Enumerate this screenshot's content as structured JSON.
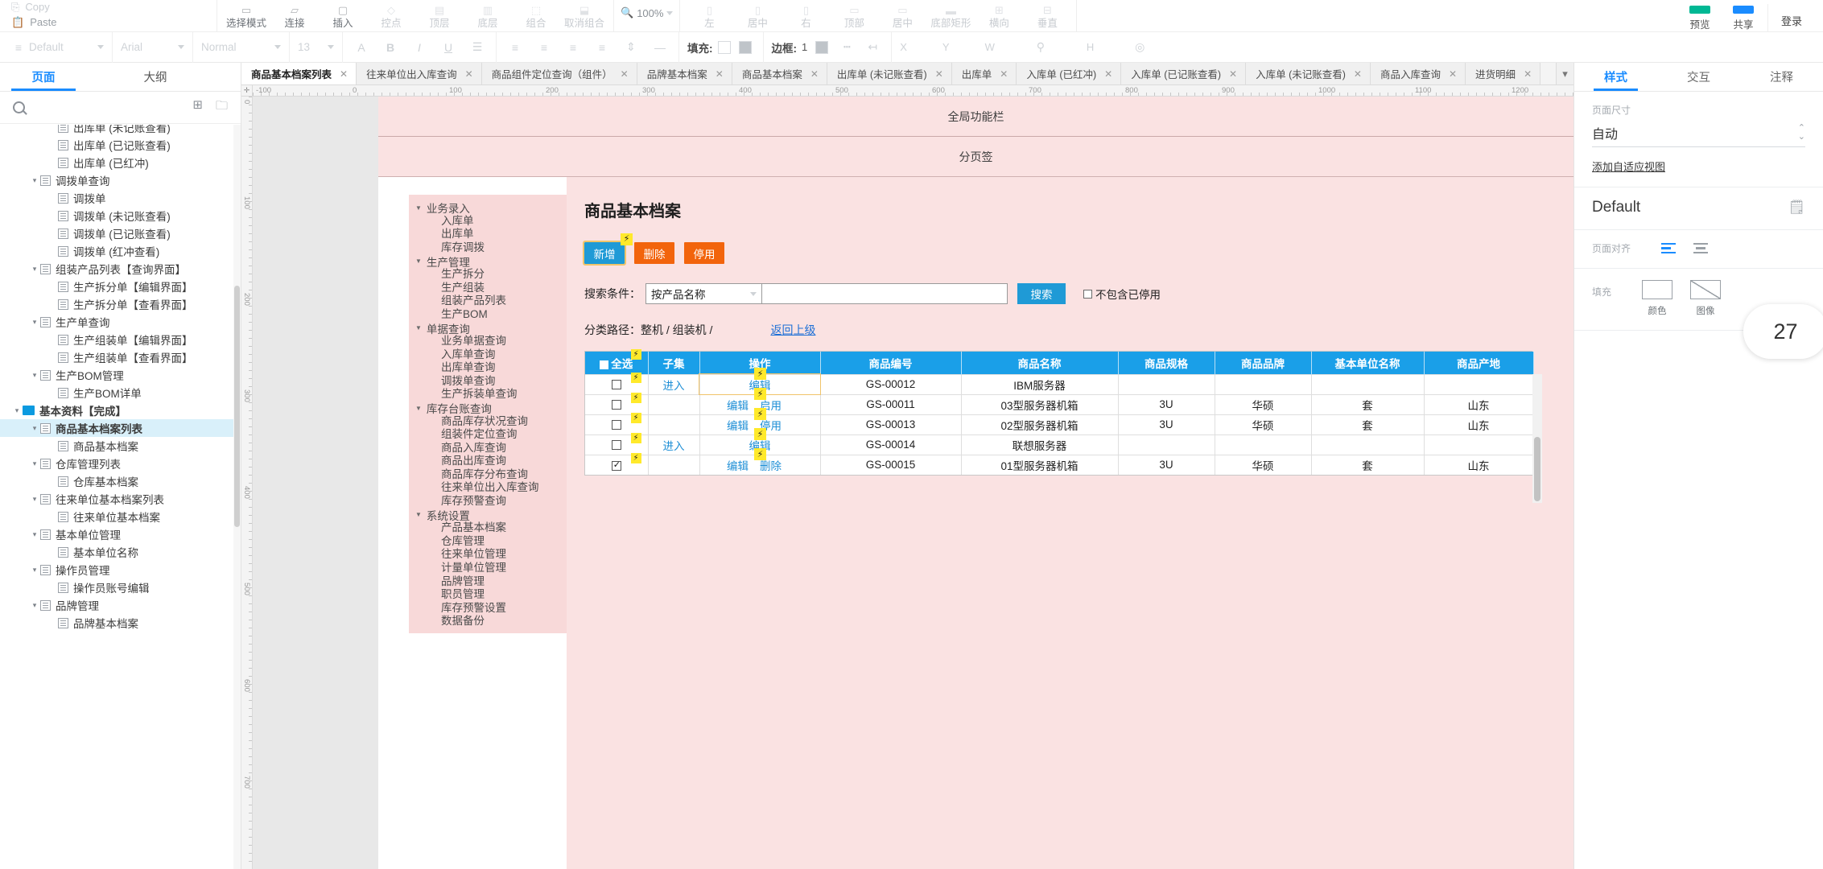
{
  "ribbon": {
    "clipboard": [
      {
        "icon": "copy-icon",
        "label": "Copy"
      },
      {
        "icon": "paste-icon",
        "label": "Paste"
      }
    ],
    "groups": [
      {
        "items": [
          {
            "label": "选择模式",
            "icon": "select-mode-icon",
            "dim": false
          },
          {
            "label": "连接",
            "icon": "connect-icon",
            "dim": false
          },
          {
            "label": "插入",
            "icon": "insert-icon",
            "dim": false
          },
          {
            "label": "控点",
            "icon": "handle-icon",
            "dim": true
          },
          {
            "label": "顶层",
            "icon": "bring-front-icon",
            "dim": true
          },
          {
            "label": "底层",
            "icon": "send-back-icon",
            "dim": true
          },
          {
            "label": "组合",
            "icon": "group-icon",
            "dim": true
          },
          {
            "label": "取消组合",
            "icon": "ungroup-icon",
            "dim": true
          }
        ]
      },
      {
        "items": [
          {
            "label": "左",
            "icon": "align-left-icon",
            "dim": true
          },
          {
            "label": "居中",
            "icon": "align-center-icon",
            "dim": true
          },
          {
            "label": "右",
            "icon": "align-right-icon",
            "dim": true
          },
          {
            "label": "顶部",
            "icon": "align-top-icon",
            "dim": true
          },
          {
            "label": "居中",
            "icon": "align-middle-icon",
            "dim": true
          },
          {
            "label": "底部矩形",
            "icon": "align-bottom-icon",
            "dim": true
          },
          {
            "label": "横向",
            "icon": "distribute-horizontal-icon",
            "dim": true
          },
          {
            "label": "垂直",
            "icon": "distribute-vertical-icon",
            "dim": true
          }
        ]
      }
    ],
    "zoom": "100%",
    "right": [
      {
        "label": "预览",
        "icon": "preview-icon",
        "color": "#00b894"
      },
      {
        "label": "共享",
        "icon": "share-icon",
        "color": "#1a8cff"
      }
    ],
    "login": "登录"
  },
  "format_bar": {
    "style": "Default",
    "font": "Arial",
    "weight": "Normal",
    "size": "13",
    "fill_label": "填充:",
    "border_label": "边框:",
    "border_width": "1",
    "x_label": "X",
    "y_label": "Y",
    "w_label": "W",
    "h_label": "H"
  },
  "tabstrip": {
    "tabs": [
      {
        "label": "商品基本档案列表",
        "active": true
      },
      {
        "label": "往来单位出入库查询",
        "active": false
      },
      {
        "label": "商品组件定位查询（组件）",
        "active": false
      },
      {
        "label": "品牌基本档案",
        "active": false
      },
      {
        "label": "商品基本档案",
        "active": false
      },
      {
        "label": "出库单 (未记账查看)",
        "active": false
      },
      {
        "label": "出库单",
        "active": false
      },
      {
        "label": "入库单 (已红冲)",
        "active": false
      },
      {
        "label": "入库单 (已记账查看)",
        "active": false
      },
      {
        "label": "入库单 (未记账查看)",
        "active": false
      },
      {
        "label": "商品入库查询",
        "active": false
      },
      {
        "label": "进货明细",
        "active": false
      }
    ],
    "close_glyph": "✕",
    "more_glyph": "▾"
  },
  "left_panel": {
    "tabs": [
      {
        "label": "页面",
        "active": true
      },
      {
        "label": "大纲",
        "active": false
      }
    ],
    "search_placeholder": "",
    "tools": [
      {
        "name": "add-page-icon",
        "glyph": "⊞"
      },
      {
        "name": "new-folder-icon",
        "glyph": "🗀"
      }
    ],
    "tree": [
      {
        "label": "出库单 (未记账查看)",
        "depth": 2,
        "type": "page",
        "expand": "",
        "partial": true
      },
      {
        "label": "出库单 (已记账查看)",
        "depth": 2,
        "type": "page",
        "expand": ""
      },
      {
        "label": "出库单 (已红冲)",
        "depth": 2,
        "type": "page",
        "expand": ""
      },
      {
        "label": "调拨单查询",
        "depth": 1,
        "type": "page",
        "expand": "▾"
      },
      {
        "label": "调拨单",
        "depth": 2,
        "type": "page",
        "expand": ""
      },
      {
        "label": "调拨单 (未记账查看)",
        "depth": 2,
        "type": "page",
        "expand": ""
      },
      {
        "label": "调拨单 (已记账查看)",
        "depth": 2,
        "type": "page",
        "expand": ""
      },
      {
        "label": "调拨单 (红冲查看)",
        "depth": 2,
        "type": "page",
        "expand": ""
      },
      {
        "label": "组装产品列表【查询界面】",
        "depth": 1,
        "type": "page",
        "expand": "▾"
      },
      {
        "label": "生产拆分单【编辑界面】",
        "depth": 2,
        "type": "page",
        "expand": ""
      },
      {
        "label": "生产拆分单【查看界面】",
        "depth": 2,
        "type": "page",
        "expand": ""
      },
      {
        "label": "生产单查询",
        "depth": 1,
        "type": "page",
        "expand": "▾"
      },
      {
        "label": "生产组装单【编辑界面】",
        "depth": 2,
        "type": "page",
        "expand": ""
      },
      {
        "label": "生产组装单【查看界面】",
        "depth": 2,
        "type": "page",
        "expand": ""
      },
      {
        "label": "生产BOM管理",
        "depth": 1,
        "type": "page",
        "expand": "▾"
      },
      {
        "label": "生产BOM详单",
        "depth": 2,
        "type": "page",
        "expand": ""
      },
      {
        "label": "基本资料【完成】",
        "depth": 0,
        "type": "folder",
        "expand": "▾"
      },
      {
        "label": "商品基本档案列表",
        "depth": 1,
        "type": "page",
        "expand": "▾",
        "selected": true
      },
      {
        "label": "商品基本档案",
        "depth": 2,
        "type": "page",
        "expand": ""
      },
      {
        "label": "仓库管理列表",
        "depth": 1,
        "type": "page",
        "expand": "▾"
      },
      {
        "label": "仓库基本档案",
        "depth": 2,
        "type": "page",
        "expand": ""
      },
      {
        "label": "往来单位基本档案列表",
        "depth": 1,
        "type": "page",
        "expand": "▾"
      },
      {
        "label": "往来单位基本档案",
        "depth": 2,
        "type": "page",
        "expand": ""
      },
      {
        "label": "基本单位管理",
        "depth": 1,
        "type": "page",
        "expand": "▾"
      },
      {
        "label": "基本单位名称",
        "depth": 2,
        "type": "page",
        "expand": ""
      },
      {
        "label": "操作员管理",
        "depth": 1,
        "type": "page",
        "expand": "▾"
      },
      {
        "label": "操作员账号编辑",
        "depth": 2,
        "type": "page",
        "expand": ""
      },
      {
        "label": "品牌管理",
        "depth": 1,
        "type": "page",
        "expand": "▾"
      },
      {
        "label": "品牌基本档案",
        "depth": 2,
        "type": "page",
        "expand": ""
      }
    ]
  },
  "rulers": {
    "horizontal": [
      "-100",
      "0",
      "100",
      "200",
      "300",
      "400",
      "500",
      "600",
      "700",
      "800",
      "900",
      "1000",
      "1100",
      "1200"
    ],
    "vertical": [
      "0",
      "100",
      "200",
      "300",
      "400",
      "500",
      "600",
      "700"
    ]
  },
  "canvas": {
    "band_global": "全局功能栏",
    "band_tabs": "分页签",
    "nav": [
      {
        "label": "业务录入",
        "group": true
      },
      {
        "label": "入库单",
        "group": false
      },
      {
        "label": "出库单",
        "group": false
      },
      {
        "label": "库存调拨",
        "group": false
      },
      {
        "label": "生产管理",
        "group": true
      },
      {
        "label": "生产拆分",
        "group": false
      },
      {
        "label": "生产组装",
        "group": false
      },
      {
        "label": "组装产品列表",
        "group": false
      },
      {
        "label": "生产BOM",
        "group": false
      },
      {
        "label": "单据查询",
        "group": true
      },
      {
        "label": "业务单据查询",
        "group": false
      },
      {
        "label": "入库单查询",
        "group": false
      },
      {
        "label": "出库单查询",
        "group": false
      },
      {
        "label": "调拨单查询",
        "group": false
      },
      {
        "label": "生产拆装单查询",
        "group": false
      },
      {
        "label": "库存台账查询",
        "group": true
      },
      {
        "label": "商品库存状况查询",
        "group": false
      },
      {
        "label": "组装件定位查询",
        "group": false
      },
      {
        "label": "商品入库查询",
        "group": false
      },
      {
        "label": "商品出库查询",
        "group": false
      },
      {
        "label": "商品库存分布查询",
        "group": false
      },
      {
        "label": "往来单位出入库查询",
        "group": false
      },
      {
        "label": "库存预警查询",
        "group": false
      },
      {
        "label": "系统设置",
        "group": true
      },
      {
        "label": "产品基本档案",
        "group": false
      },
      {
        "label": "仓库管理",
        "group": false
      },
      {
        "label": "往来单位管理",
        "group": false
      },
      {
        "label": "计量单位管理",
        "group": false
      },
      {
        "label": "品牌管理",
        "group": false
      },
      {
        "label": "职员管理",
        "group": false
      },
      {
        "label": "库存预警设置",
        "group": false
      },
      {
        "label": "数据备份",
        "group": false
      }
    ],
    "title": "商品基本档案",
    "buttons": [
      {
        "label": "新增",
        "style": "blue",
        "bolt": true
      },
      {
        "label": "删除",
        "style": "orange",
        "bolt": false
      },
      {
        "label": "停用",
        "style": "orange",
        "bolt": false
      }
    ],
    "search": {
      "label": "搜索条件：",
      "select_value": "按产品名称",
      "input_value": "",
      "input_placeholder": "",
      "button": "搜索",
      "checkbox_label": "不包含已停用",
      "checkbox_checked": false
    },
    "path": {
      "label": "分类路径：",
      "value": "整机 /  组装机 /",
      "back": "返回上级"
    },
    "table": {
      "select_all_label": "全选",
      "columns": [
        "子集",
        "操作",
        "商品编号",
        "商品名称",
        "商品规格",
        "商品品牌",
        "基本单位名称",
        "商品产地"
      ],
      "rows": [
        {
          "checked": false,
          "subset": "进入",
          "ops": [
            "编辑"
          ],
          "code": "GS-00012",
          "name": "IBM服务器",
          "spec": "",
          "brand": "",
          "unit": "",
          "origin": "",
          "op_highlight": true
        },
        {
          "checked": false,
          "subset": "",
          "ops": [
            "编辑",
            "启用"
          ],
          "code": "GS-00011",
          "name": "03型服务器机箱",
          "spec": "3U",
          "brand": "华硕",
          "unit": "套",
          "origin": "山东",
          "op_highlight": false
        },
        {
          "checked": false,
          "subset": "",
          "ops": [
            "编辑",
            "停用"
          ],
          "code": "GS-00013",
          "name": "02型服务器机箱",
          "spec": "3U",
          "brand": "华硕",
          "unit": "套",
          "origin": "山东",
          "op_highlight": false
        },
        {
          "checked": false,
          "subset": "进入",
          "ops": [
            "编辑"
          ],
          "code": "GS-00014",
          "name": "联想服务器",
          "spec": "",
          "brand": "",
          "unit": "",
          "origin": "",
          "op_highlight": false
        },
        {
          "checked": true,
          "subset": "",
          "ops": [
            "编辑",
            "删除"
          ],
          "code": "GS-00015",
          "name": "01型服务器机箱",
          "spec": "3U",
          "brand": "华硕",
          "unit": "套",
          "origin": "山东",
          "op_highlight": false
        }
      ]
    }
  },
  "right_panel": {
    "tabs": [
      {
        "label": "样式",
        "active": true
      },
      {
        "label": "交互",
        "active": false
      },
      {
        "label": "注释",
        "active": false
      }
    ],
    "page_size_label": "页面尺寸",
    "page_size_value": "自动",
    "adaptive_link": "添加自适应视图",
    "style_name": "Default",
    "page_align_label": "页面对齐",
    "fill_label": "填充",
    "fill_options": [
      {
        "label": "颜色",
        "icon": "fill-color-icon"
      },
      {
        "label": "图像",
        "icon": "fill-image-icon"
      }
    ],
    "badge": "27"
  }
}
